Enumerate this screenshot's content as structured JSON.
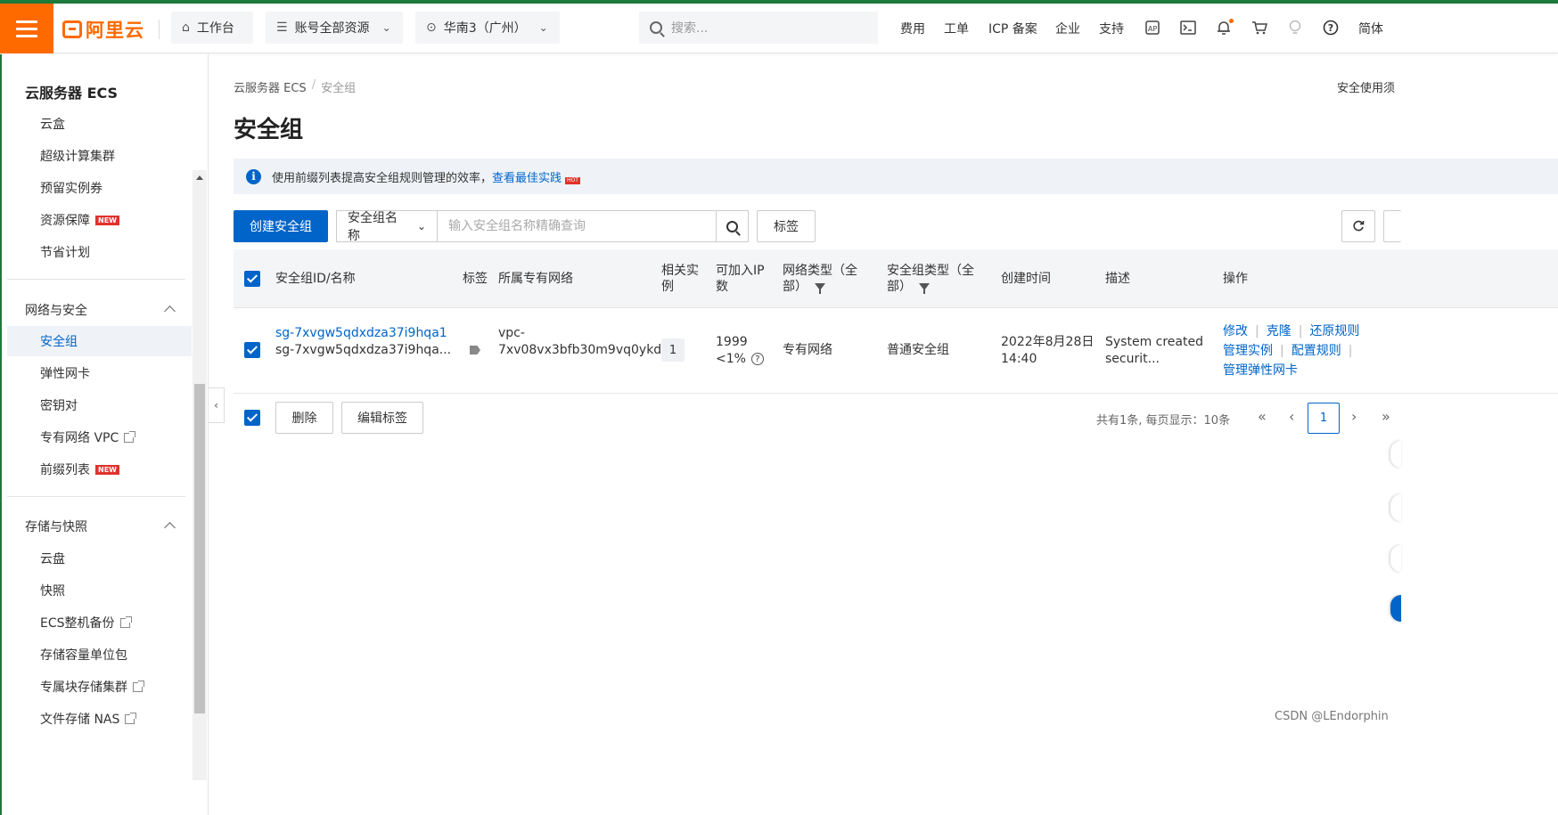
{
  "topbar": {
    "logo_text": "阿里云",
    "workbench": "工作台",
    "account": "账号全部资源",
    "region": "华南3（广州）",
    "search_placeholder": "搜索...",
    "nav": [
      "费用",
      "工单",
      "ICP 备案",
      "企业",
      "支持"
    ],
    "lang": "简体",
    "icons": [
      "app-icon",
      "terminal-icon",
      "bell-icon",
      "cart-icon",
      "lightbulb-icon",
      "help-icon"
    ]
  },
  "sidebar": {
    "title": "云服务器 ECS",
    "items_top": [
      "云盒",
      "超级计算集群",
      "预留实例券",
      "资源保障",
      "节省计划"
    ],
    "group_network": "网络与安全",
    "items_network": [
      "安全组",
      "弹性网卡",
      "密钥对",
      "专有网络 VPC",
      "前缀列表"
    ],
    "group_storage": "存储与快照",
    "items_storage": [
      "云盘",
      "快照",
      "ECS整机备份",
      "存储容量单位包",
      "专属块存储集群",
      "文件存储 NAS"
    ],
    "new_badge": "NEW"
  },
  "breadcrumb": {
    "root": "云服务器 ECS",
    "sep": "/",
    "current": "安全组"
  },
  "top_right_text": "安全使用须",
  "page_title": "安全组",
  "notice": {
    "text": "使用前缀列表提高安全组规则管理的效率，",
    "link": "查看最佳实践",
    "hot": "HOT"
  },
  "toolbar": {
    "create": "创建安全组",
    "filter_select": "安全组名称",
    "filter_placeholder": "输入安全组名称精确查询",
    "tag_button": "标签"
  },
  "table": {
    "headers": {
      "id_name": "安全组ID/名称",
      "tag": "标签",
      "vpc": "所属专有网络",
      "instances_1": "相关实",
      "instances_2": "例",
      "ip_1": "可加入IP",
      "ip_2": "数",
      "net_type_1": "网络类型（全",
      "net_type_2": "部）",
      "sg_type_1": "安全组类型（全",
      "sg_type_2": "部）",
      "created": "创建时间",
      "desc": "描述",
      "ops": "操作"
    },
    "rows": [
      {
        "id": "sg-7xvgw5qdxdza37i9hqa1",
        "name": "sg-7xvgw5qdxdza37i9hqa...",
        "vpc_1": "vpc-",
        "vpc_2": "7xv08vx3bfb30m9vq0ykd",
        "instances": "1",
        "ip_count": "1999",
        "ip_pct": "<1%",
        "net_type": "专有网络",
        "sg_type": "普通安全组",
        "created_1": "2022年8月28日",
        "created_2": "14:40",
        "desc_1": "System created",
        "desc_2": "securit...",
        "ops": [
          "修改",
          "克隆",
          "还原规则",
          "管理实例",
          "配置规则",
          "管理弹性网卡"
        ]
      }
    ]
  },
  "footer": {
    "delete": "删除",
    "edit_tags": "编辑标签",
    "pager_info": "共有1条, 每页显示：10条",
    "page_current": "1",
    "first": "«",
    "prev": "‹",
    "next": "›",
    "last": "»"
  },
  "watermark": "CSDN @LEndorphin"
}
